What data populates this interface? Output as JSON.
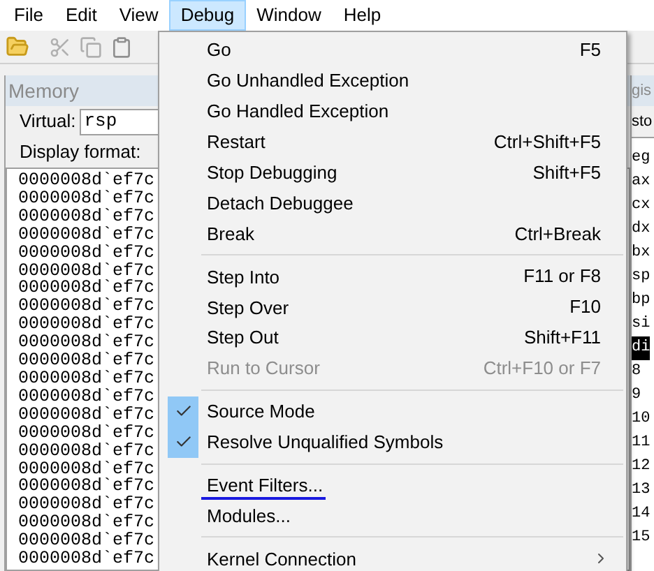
{
  "menubar": [
    {
      "label": "File",
      "selected": false
    },
    {
      "label": "Edit",
      "selected": false
    },
    {
      "label": "View",
      "selected": false
    },
    {
      "label": "Debug",
      "selected": true
    },
    {
      "label": "Window",
      "selected": false
    },
    {
      "label": "Help",
      "selected": false
    }
  ],
  "memory": {
    "title": "Memory",
    "virtual_label": "Virtual:",
    "virtual_value": "rsp",
    "format_label": "Display format:",
    "rows": [
      "0000008d`ef7c",
      "0000008d`ef7c",
      "0000008d`ef7c",
      "0000008d`ef7c",
      "0000008d`ef7c",
      "0000008d`ef7c",
      "0000008d`ef7c",
      "0000008d`ef7c",
      "0000008d`ef7c",
      "0000008d`ef7c",
      "0000008d`ef7c",
      "0000008d`ef7c",
      "0000008d`ef7c",
      "0000008d`ef7c",
      "0000008d`ef7c",
      "0000008d`ef7c",
      "0000008d`ef7c",
      "0000008d`ef7c",
      "0000008d`ef7c",
      "0000008d`ef7c",
      "0000008d`ef7c",
      "0000008d`ef7c"
    ]
  },
  "registers": {
    "title": "gis",
    "header": "sto",
    "rows": [
      {
        "name": "eg",
        "selected": false
      },
      {
        "name": "ax",
        "selected": false
      },
      {
        "name": "cx",
        "selected": false
      },
      {
        "name": "dx",
        "selected": false
      },
      {
        "name": "bx",
        "selected": false
      },
      {
        "name": "sp",
        "selected": false
      },
      {
        "name": "bp",
        "selected": false
      },
      {
        "name": "si",
        "selected": false
      },
      {
        "name": "di",
        "selected": true
      },
      {
        "name": "8",
        "selected": false
      },
      {
        "name": "9",
        "selected": false
      },
      {
        "name": "10",
        "selected": false
      },
      {
        "name": "11",
        "selected": false
      },
      {
        "name": "12",
        "selected": false
      },
      {
        "name": "13",
        "selected": false
      },
      {
        "name": "14",
        "selected": false
      },
      {
        "name": "15",
        "selected": false
      }
    ]
  },
  "debug_menu": [
    {
      "kind": "item",
      "label": "Go",
      "shortcut": "F5",
      "checked": false,
      "disabled": false,
      "submenu": false,
      "underlined": false
    },
    {
      "kind": "item",
      "label": "Go Unhandled Exception",
      "checked": false,
      "disabled": false,
      "submenu": false,
      "underlined": false
    },
    {
      "kind": "item",
      "label": "Go Handled Exception",
      "checked": false,
      "disabled": false,
      "submenu": false,
      "underlined": false
    },
    {
      "kind": "item",
      "label": "Restart",
      "shortcut": "Ctrl+Shift+F5",
      "checked": false,
      "disabled": false,
      "submenu": false,
      "underlined": false
    },
    {
      "kind": "item",
      "label": "Stop Debugging",
      "shortcut": "Shift+F5",
      "checked": false,
      "disabled": false,
      "submenu": false,
      "underlined": false
    },
    {
      "kind": "item",
      "label": "Detach Debuggee",
      "checked": false,
      "disabled": false,
      "submenu": false,
      "underlined": false
    },
    {
      "kind": "item",
      "label": "Break",
      "shortcut": "Ctrl+Break",
      "checked": false,
      "disabled": false,
      "submenu": false,
      "underlined": false
    },
    {
      "kind": "separator"
    },
    {
      "kind": "item",
      "label": "Step Into",
      "shortcut": "F11 or F8",
      "checked": false,
      "disabled": false,
      "submenu": false,
      "underlined": false
    },
    {
      "kind": "item",
      "label": "Step Over",
      "shortcut": "F10",
      "checked": false,
      "disabled": false,
      "submenu": false,
      "underlined": false
    },
    {
      "kind": "item",
      "label": "Step Out",
      "shortcut": "Shift+F11",
      "checked": false,
      "disabled": false,
      "submenu": false,
      "underlined": false
    },
    {
      "kind": "item",
      "label": "Run to Cursor",
      "shortcut": "Ctrl+F10 or F7",
      "checked": false,
      "disabled": true,
      "submenu": false,
      "underlined": false
    },
    {
      "kind": "separator"
    },
    {
      "kind": "item",
      "label": "Source Mode",
      "checked": true,
      "disabled": false,
      "submenu": false,
      "underlined": false
    },
    {
      "kind": "item",
      "label": "Resolve Unqualified Symbols",
      "checked": true,
      "disabled": false,
      "submenu": false,
      "underlined": false
    },
    {
      "kind": "separator"
    },
    {
      "kind": "item",
      "label": "Event Filters...",
      "checked": false,
      "disabled": false,
      "submenu": false,
      "underlined": true
    },
    {
      "kind": "item",
      "label": "Modules...",
      "checked": false,
      "disabled": false,
      "submenu": false,
      "underlined": false
    },
    {
      "kind": "separator"
    },
    {
      "kind": "item",
      "label": "Kernel Connection",
      "checked": false,
      "disabled": false,
      "submenu": true,
      "underlined": false
    }
  ]
}
